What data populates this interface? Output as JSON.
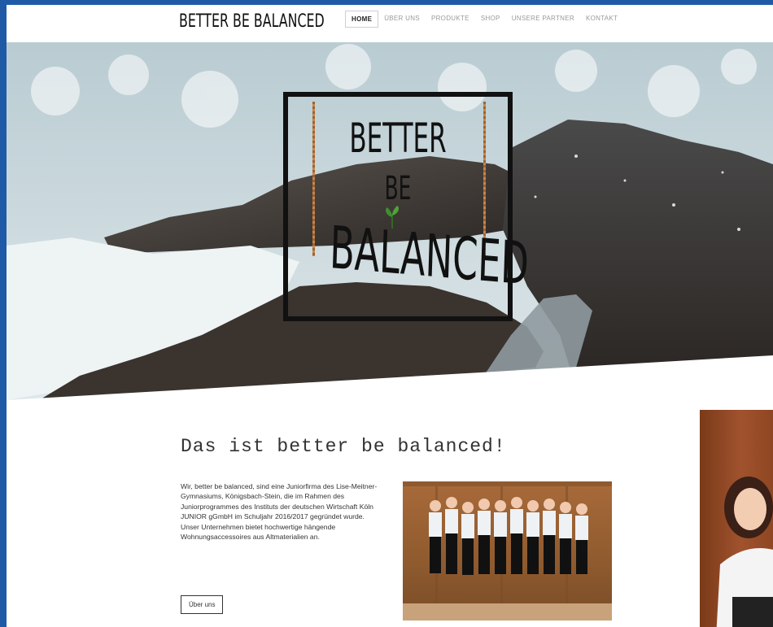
{
  "header": {
    "logo": "BETTER BE BALANCED",
    "nav": [
      {
        "label": "HOME",
        "active": true
      },
      {
        "label": "ÜBER UNS",
        "active": false
      },
      {
        "label": "PRODUKTE",
        "active": false
      },
      {
        "label": "SHOP",
        "active": false
      },
      {
        "label": "UNSERE PARTNER",
        "active": false
      },
      {
        "label": "KONTAKT",
        "active": false
      }
    ]
  },
  "hero": {
    "logo_line1": "BETTER",
    "logo_line2": "BE",
    "logo_line3": "BALANCED"
  },
  "main": {
    "headline": "Das ist better be balanced!",
    "intro_p1": "Wir, better be balanced, sind eine Juniorfirma des Lise-Meitner-Gymnasiums, Königsbach-Stein, die im Rahmen des Juniorprogrammes des Instituts der deutschen Wirtschaft Köln JUNIOR gGmbH im Schuljahr 2016/2017 gegründet wurde.",
    "intro_p2": "Unser Unternehmen bietet hochwertige hängende Wohnungsaccessoires aus Altmaterialien an.",
    "about_button": "Über uns"
  },
  "colors": {
    "page_border": "#1e5aa6",
    "text": "#333333",
    "rope": "#a0632f",
    "wood": "#a86a3a"
  }
}
